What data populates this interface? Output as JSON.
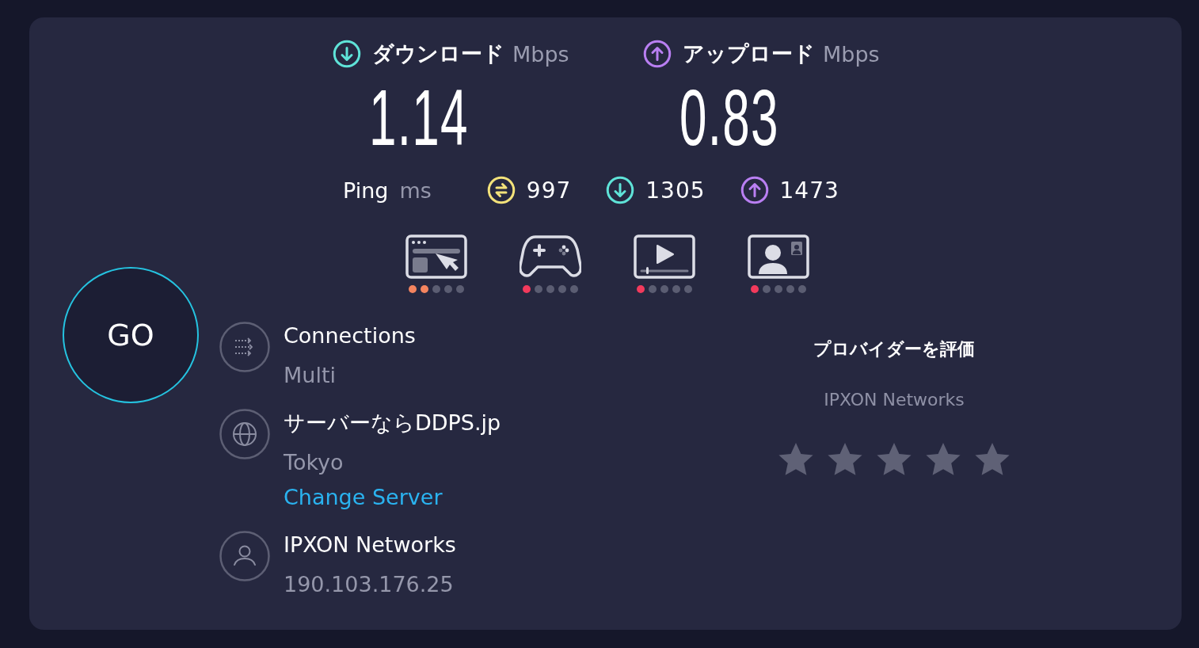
{
  "speeds": [
    {
      "kind": "download",
      "label": "ダウンロード",
      "unit": "Mbps",
      "value": "1.14"
    },
    {
      "kind": "upload",
      "label": "アップロード",
      "unit": "Mbps",
      "value": "0.83"
    }
  ],
  "ping": {
    "label": "Ping",
    "unit": "ms",
    "values": [
      {
        "kind": "idle",
        "value": "997"
      },
      {
        "kind": "download",
        "value": "1305"
      },
      {
        "kind": "upload",
        "value": "1473"
      }
    ]
  },
  "activities": [
    {
      "kind": "browsing",
      "stars": 2,
      "color": "#f4845f"
    },
    {
      "kind": "gaming",
      "stars": 1,
      "color": "#f23a5c"
    },
    {
      "kind": "streaming",
      "stars": 1,
      "color": "#f23a5c"
    },
    {
      "kind": "video_call",
      "stars": 1,
      "color": "#f23a5c"
    }
  ],
  "go_button": "GO",
  "info": [
    {
      "kind": "connections",
      "title": "Connections",
      "lines": [
        "Multi"
      ]
    },
    {
      "kind": "server",
      "title": "サーバーならDDPS.jp",
      "lines": [
        "Tokyo"
      ],
      "link": "Change Server"
    },
    {
      "kind": "provider",
      "title": "IPXON Networks",
      "lines": [
        "190.103.176.25"
      ]
    }
  ],
  "rating": {
    "title": "プロバイダーを評価",
    "provider": "IPXON Networks",
    "stars": 0
  }
}
